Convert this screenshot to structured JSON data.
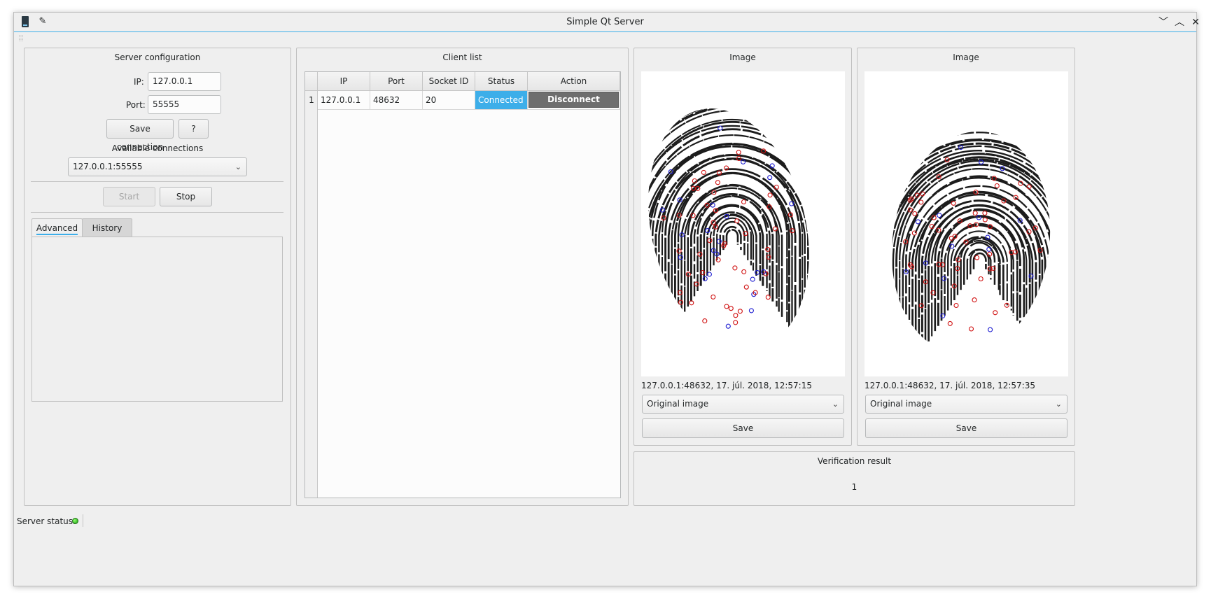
{
  "window": {
    "title": "Simple Qt Server"
  },
  "server_config": {
    "title": "Server configuration",
    "ip_label": "IP:",
    "ip_value": "127.0.0.1",
    "port_label": "Port:",
    "port_value": "55555",
    "save_connection_label": "Save connection",
    "help_label": "?",
    "available_connections_label": "Available connections",
    "selected_connection": "127.0.0.1:55555",
    "start_label": "Start",
    "stop_label": "Stop",
    "tabs": [
      {
        "label": "Advanced",
        "active": true
      },
      {
        "label": "History",
        "active": false
      }
    ]
  },
  "client_list": {
    "title": "Client list",
    "columns": [
      "IP",
      "Port",
      "Socket ID",
      "Status",
      "Action"
    ],
    "rows": [
      {
        "num": "1",
        "ip": "127.0.0.1",
        "port": "48632",
        "socket_id": "20",
        "status": "Connected",
        "action": "Disconnect"
      }
    ]
  },
  "image_panels": [
    {
      "title": "Image",
      "caption": "127.0.0.1:48632, 17. júl. 2018, 12:57:15",
      "mode": "Original image",
      "save_label": "Save"
    },
    {
      "title": "Image",
      "caption": "127.0.0.1:48632, 17. júl. 2018, 12:57:35",
      "mode": "Original image",
      "save_label": "Save"
    }
  ],
  "verification": {
    "title": "Verification result",
    "value": "1"
  },
  "statusbar": {
    "label": "Server status:",
    "led_color": "#1a9b10"
  },
  "colors": {
    "accent": "#3daee9",
    "minutia_red": "#d01010",
    "minutia_blue": "#1a1ad0"
  }
}
